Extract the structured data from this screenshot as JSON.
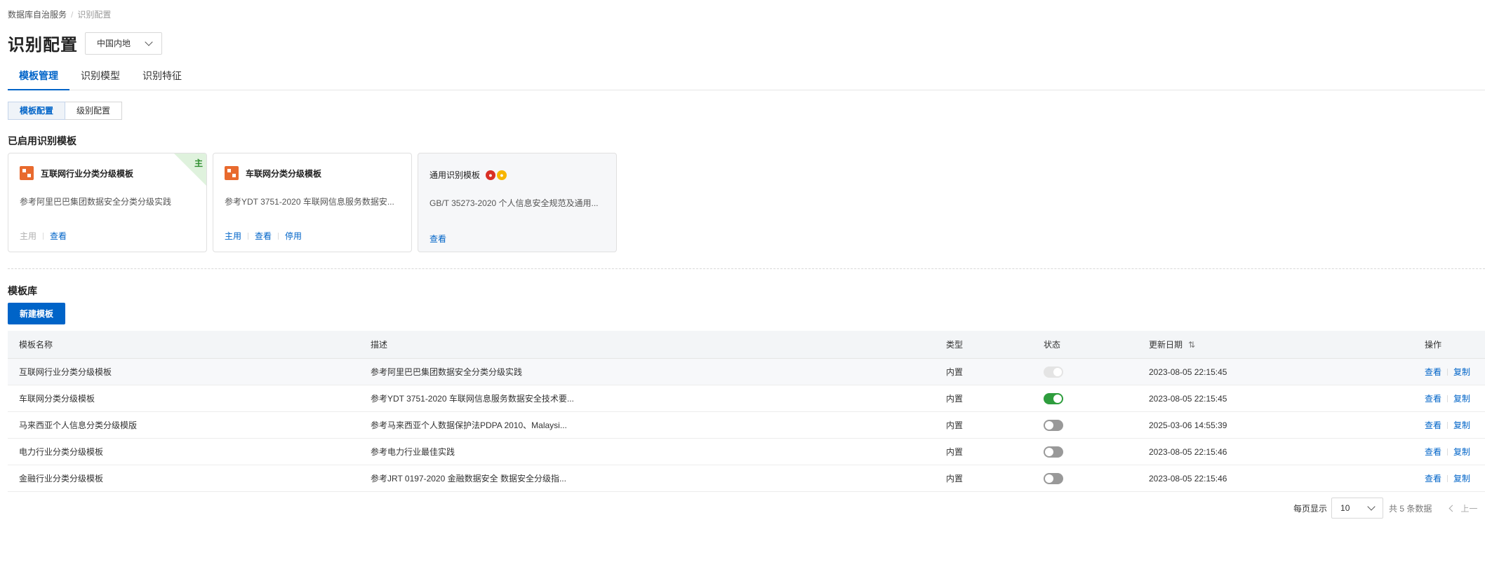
{
  "breadcrumb": {
    "root": "数据库自治服务",
    "separator": "/",
    "current": "识别配置"
  },
  "header": {
    "title": "识别配置",
    "region": "中国内地"
  },
  "tabs": [
    {
      "label": "模板管理",
      "active": true
    },
    {
      "label": "识别模型",
      "active": false
    },
    {
      "label": "识别特征",
      "active": false
    }
  ],
  "segment": [
    {
      "label": "模板配置",
      "active": true
    },
    {
      "label": "级别配置",
      "active": false
    }
  ],
  "enabled_section": {
    "title": "已启用识别模板",
    "cards": [
      {
        "name": "互联网行业分类分级模板",
        "desc": "参考阿里巴巴集团数据安全分类分级实践",
        "corner_label": "主",
        "actions": [
          {
            "label": "主用",
            "disabled": true
          },
          {
            "label": "查看",
            "disabled": false
          }
        ]
      },
      {
        "name": "车联网分类分级模板",
        "desc": "参考YDT 3751-2020 车联网信息服务数据安...",
        "actions": [
          {
            "label": "主用",
            "disabled": false
          },
          {
            "label": "查看",
            "disabled": false
          },
          {
            "label": "停用",
            "disabled": false
          }
        ]
      },
      {
        "name": "通用识别模板",
        "desc": "GB/T 35273-2020 个人信息安全规范及通用...",
        "actions": [
          {
            "label": "查看",
            "disabled": false
          }
        ]
      }
    ]
  },
  "library": {
    "title": "模板库",
    "new_button": "新建模板",
    "columns": {
      "name": "模板名称",
      "desc": "描述",
      "type": "类型",
      "status": "状态",
      "date": "更新日期",
      "op": "操作"
    },
    "rows": [
      {
        "name": "互联网行业分类分级模板",
        "desc": "参考阿里巴巴集团数据安全分类分级实践",
        "type": "内置",
        "status": "disabled-on",
        "date": "2023-08-05 22:15:45",
        "view": "查看",
        "copy": "复制"
      },
      {
        "name": "车联网分类分级模板",
        "desc": "参考YDT 3751-2020 车联网信息服务数据安全技术要...",
        "type": "内置",
        "status": "on",
        "date": "2023-08-05 22:15:45",
        "view": "查看",
        "copy": "复制"
      },
      {
        "name": "马来西亚个人信息分类分级模版",
        "desc": "参考马来西亚个人数据保护法PDPA 2010、Malaysi...",
        "type": "内置",
        "status": "off",
        "date": "2025-03-06 14:55:39",
        "view": "查看",
        "copy": "复制"
      },
      {
        "name": "电力行业分类分级模板",
        "desc": "参考电力行业最佳实践",
        "type": "内置",
        "status": "off",
        "date": "2023-08-05 22:15:46",
        "view": "查看",
        "copy": "复制"
      },
      {
        "name": "金融行业分类分级模板",
        "desc": "参考JRT 0197-2020 金融数据安全 数据安全分级指...",
        "type": "内置",
        "status": "off",
        "date": "2023-08-05 22:15:46",
        "view": "查看",
        "copy": "复制"
      }
    ]
  },
  "pagination": {
    "per_page_label": "每页显示",
    "per_page": "10",
    "total": "共 5 条数据",
    "prev": "上一"
  },
  "colors": {
    "primary": "#0064c8",
    "toggle_on": "#2e9d3d",
    "corner": "#dff2dd"
  },
  "icons": {
    "sort": "sort-icon",
    "chevron": "chevron-down-icon"
  }
}
